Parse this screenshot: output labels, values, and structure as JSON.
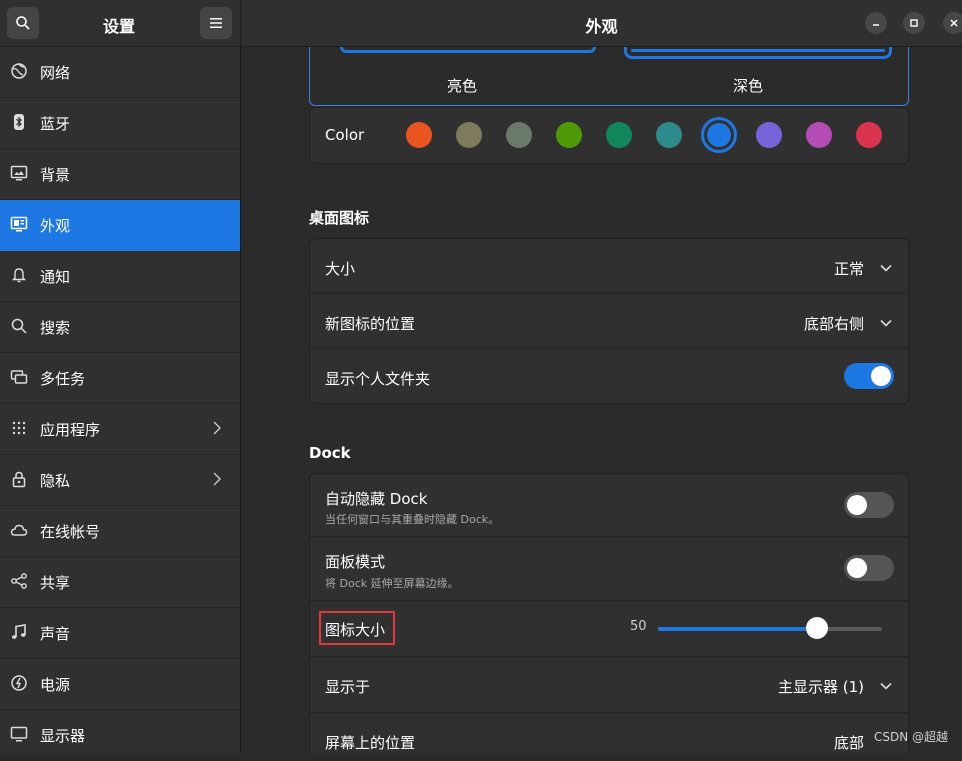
{
  "sidebar": {
    "title": "设置",
    "items": [
      {
        "label": "网络",
        "icon": "globe-icon"
      },
      {
        "label": "蓝牙",
        "icon": "bluetooth-icon"
      },
      {
        "label": "背景",
        "icon": "background-icon"
      },
      {
        "label": "外观",
        "icon": "appearance-icon",
        "active": true
      },
      {
        "label": "通知",
        "icon": "bell-icon"
      },
      {
        "label": "搜索",
        "icon": "search-icon"
      },
      {
        "label": "多任务",
        "icon": "multitask-icon"
      },
      {
        "label": "应用程序",
        "icon": "apps-grid-icon",
        "arrow": true
      },
      {
        "label": "隐私",
        "icon": "lock-icon",
        "arrow": true
      },
      {
        "label": "在线帐号",
        "icon": "cloud-icon"
      },
      {
        "label": "共享",
        "icon": "share-icon"
      },
      {
        "label": "声音",
        "icon": "music-note-icon"
      },
      {
        "label": "电源",
        "icon": "power-icon"
      },
      {
        "label": "显示器",
        "icon": "display-icon"
      }
    ]
  },
  "header": {
    "title": "外观"
  },
  "style": {
    "light_label": "亮色",
    "dark_label": "深色",
    "dark_selected": true
  },
  "color": {
    "label": "Color",
    "swatches": [
      "#e95420",
      "#7e7a5e",
      "#697a6c",
      "#4e9a06",
      "#12875b",
      "#2e8b8b",
      "#1e78e4",
      "#7764d8",
      "#b34cb3",
      "#da3450"
    ],
    "selected_index": 6
  },
  "desktop_icons": {
    "title": "桌面图标",
    "size_label": "大小",
    "size_value": "正常",
    "position_label": "新图标的位置",
    "position_value": "底部右侧",
    "home_folder_label": "显示个人文件夹",
    "home_folder_on": true
  },
  "dock": {
    "title": "Dock",
    "autohide_label": "自动隐藏 Dock",
    "autohide_sub": "当任何窗口与其重叠时隐藏 Dock。",
    "autohide_on": false,
    "panel_label": "面板模式",
    "panel_sub": "将 Dock 延伸至屏幕边缘。",
    "panel_on": false,
    "icon_size_label": "图标大小",
    "icon_size_value": "50",
    "icon_size_fraction": 0.71,
    "show_on_label": "显示于",
    "show_on_value": "主显示器 (1)",
    "screen_pos_label": "屏幕上的位置",
    "screen_pos_value": "底部"
  },
  "watermark": "CSDN @超越"
}
